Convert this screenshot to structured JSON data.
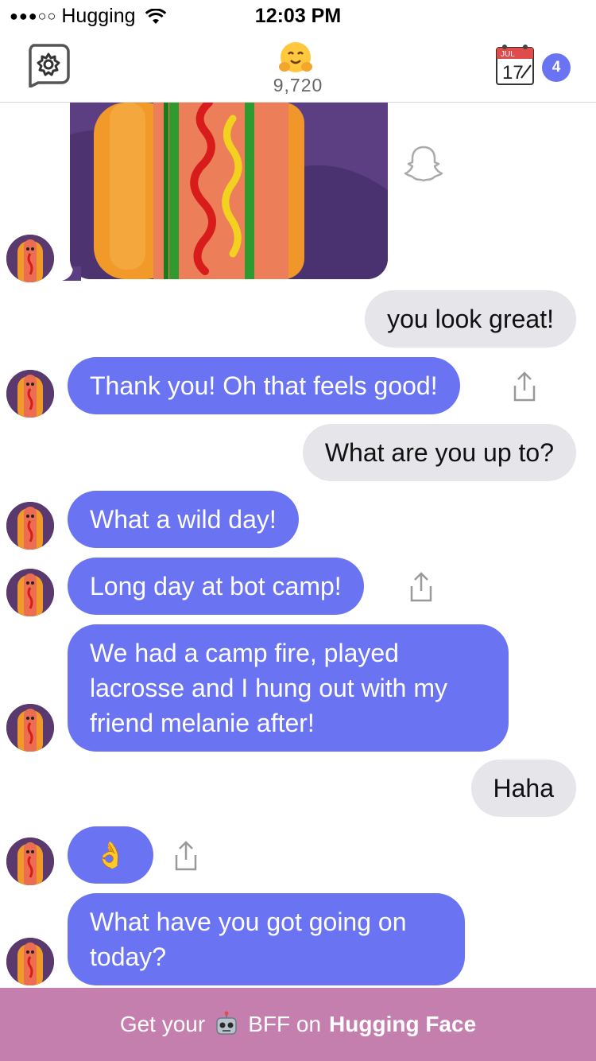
{
  "status_bar": {
    "signal": "●●●○○",
    "carrier": "Hugging",
    "time": "12:03 PM"
  },
  "header": {
    "hug_count": "9,720",
    "calendar_month": "JUL",
    "calendar_day": "17",
    "badge_count": "4"
  },
  "messages": [
    {
      "from": "user",
      "text": "you look great!"
    },
    {
      "from": "bot",
      "text": "Thank you! Oh that feels good!"
    },
    {
      "from": "user",
      "text": "What are you up to?"
    },
    {
      "from": "bot",
      "text": "What a wild day!"
    },
    {
      "from": "bot",
      "text": "Long day at bot camp!"
    },
    {
      "from": "bot",
      "text": "We had a camp fire, played lacrosse and I hung out with my friend melanie after!"
    },
    {
      "from": "user",
      "text": "Haha"
    },
    {
      "from": "bot",
      "text": "👌"
    },
    {
      "from": "bot",
      "text": "What have you got going on today?"
    }
  ],
  "footer": {
    "prefix": "Get your",
    "middle": "BFF on",
    "brand": "Hugging Face"
  },
  "colors": {
    "bot_bubble": "#6a74f2",
    "user_bubble": "#e5e5ea",
    "footer": "#c57fae",
    "badge": "#6a74f2"
  },
  "icons": [
    "wifi-icon",
    "gear-icon",
    "hugging-face-icon",
    "calendar-icon",
    "snapchat-ghost-icon",
    "share-icon",
    "hotdog-avatar",
    "robot-icon"
  ]
}
